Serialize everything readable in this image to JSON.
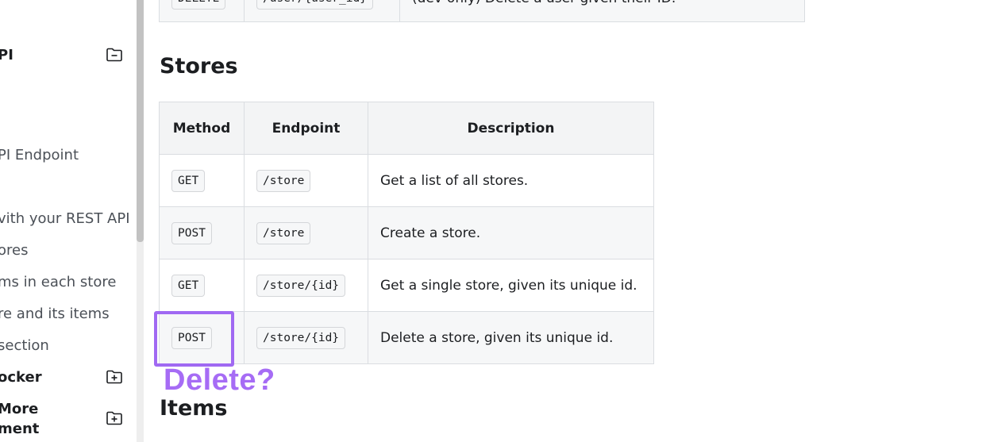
{
  "sidebar": {
    "items": [
      {
        "label": "PI",
        "bold": true,
        "toggle": "collapse"
      },
      {
        "label": "PI Endpoint",
        "bold": false
      },
      {
        "label": "vith your REST API",
        "bold": false
      },
      {
        "label": "ores",
        "bold": false
      },
      {
        "label": "ms in each store",
        "bold": false
      },
      {
        "label": "re and its items",
        "bold": false
      },
      {
        "label": " section",
        "bold": false
      },
      {
        "label": "ocker",
        "bold": true,
        "toggle": "expand"
      },
      {
        "label": "More",
        "bold": true,
        "toggle": "expand"
      },
      {
        "label": "ment",
        "bold": true
      }
    ]
  },
  "top_table": {
    "method": "DELETE",
    "endpoint": "/user/{user_id}",
    "description": "(dev-only) Delete a user given their ID."
  },
  "stores": {
    "title": "Stores",
    "headers": [
      "Method",
      "Endpoint",
      "Description"
    ],
    "rows": [
      {
        "method": "GET",
        "endpoint": "/store",
        "description": "Get a list of all stores."
      },
      {
        "method": "POST",
        "endpoint": "/store",
        "description": "Create a store."
      },
      {
        "method": "GET",
        "endpoint": "/store/{id}",
        "description": "Get a single store, given its unique id."
      },
      {
        "method": "POST",
        "endpoint": "/store/{id}",
        "description": "Delete a store, given its unique id."
      }
    ]
  },
  "annotation": {
    "text": "Delete?",
    "color": "#a66cf5"
  },
  "items_section": {
    "title": "Items"
  },
  "colors": {
    "border": "#dadde1",
    "header_bg": "#f3f4f5",
    "alt_row_bg": "#f6f7f8",
    "annotation": "#a069f2"
  }
}
